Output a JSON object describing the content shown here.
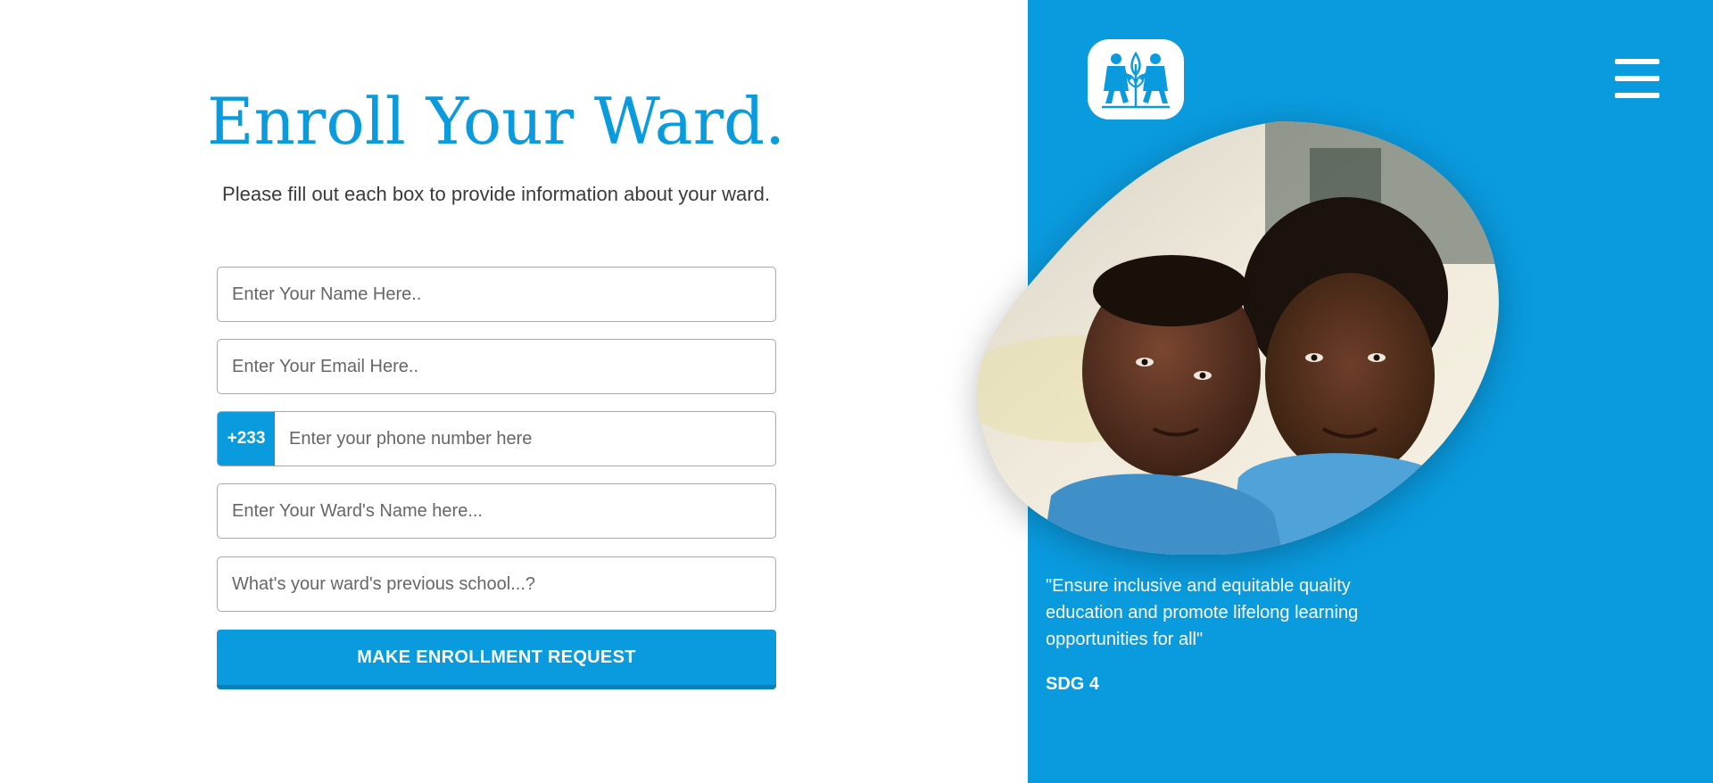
{
  "form": {
    "title": "Enroll Your Ward.",
    "subtitle": "Please fill out each box to provide information about your ward.",
    "name_placeholder": "Enter Your Name Here..",
    "email_placeholder": "Enter Your Email Here..",
    "phone_prefix": "+233",
    "phone_placeholder": "Enter your phone number here",
    "ward_name_placeholder": "Enter Your Ward's Name here...",
    "previous_school_placeholder": "What's your ward's previous school...?",
    "submit_label": "MAKE ENROLLMENT REQUEST"
  },
  "side_panel": {
    "quote": "\"Ensure inclusive and equitable quality education and promote lifelong learning opportunities for all\"",
    "attribution": "SDG 4",
    "logo_icon": "children-holding-plant-logo",
    "menu_icon": "hamburger-menu-icon"
  },
  "colors": {
    "brand_blue": "#0a9ade",
    "brand_blue_dark": "#0880bd",
    "text_dark": "#3a3a3a"
  }
}
